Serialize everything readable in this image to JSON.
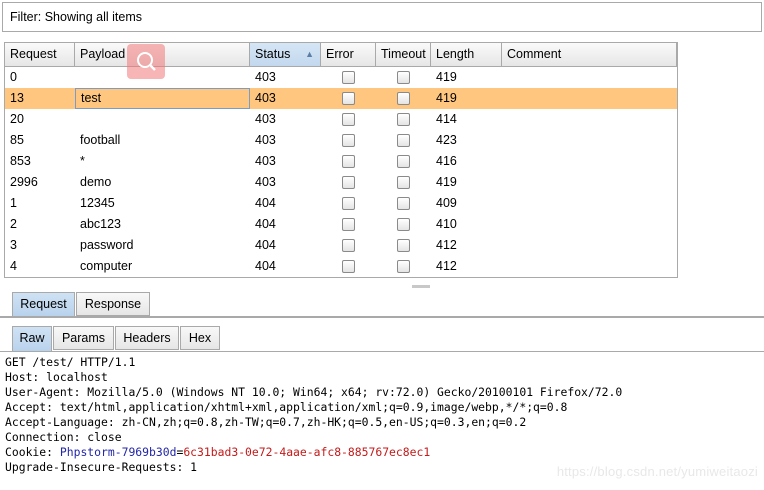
{
  "filter": {
    "label": "Filter: Showing all items"
  },
  "table": {
    "columns": [
      "Request",
      "Payload",
      "Status",
      "Error",
      "Timeout",
      "Length",
      "Comment"
    ],
    "sorted_column": "Status",
    "sort_indicator": "▲",
    "rows": [
      {
        "request": "0",
        "payload": "",
        "status": "403",
        "error": false,
        "timeout": false,
        "length": "419",
        "comment": ""
      },
      {
        "request": "13",
        "payload": "test",
        "status": "403",
        "error": false,
        "timeout": false,
        "length": "419",
        "comment": "",
        "selected": true
      },
      {
        "request": "20",
        "payload": "",
        "status": "403",
        "error": false,
        "timeout": false,
        "length": "414",
        "comment": ""
      },
      {
        "request": "85",
        "payload": "football",
        "status": "403",
        "error": false,
        "timeout": false,
        "length": "423",
        "comment": ""
      },
      {
        "request": "853",
        "payload": "*",
        "status": "403",
        "error": false,
        "timeout": false,
        "length": "416",
        "comment": ""
      },
      {
        "request": "2996",
        "payload": "demo",
        "status": "403",
        "error": false,
        "timeout": false,
        "length": "419",
        "comment": ""
      },
      {
        "request": "1",
        "payload": "12345",
        "status": "404",
        "error": false,
        "timeout": false,
        "length": "409",
        "comment": ""
      },
      {
        "request": "2",
        "payload": "abc123",
        "status": "404",
        "error": false,
        "timeout": false,
        "length": "410",
        "comment": ""
      },
      {
        "request": "3",
        "payload": "password",
        "status": "404",
        "error": false,
        "timeout": false,
        "length": "412",
        "comment": ""
      },
      {
        "request": "4",
        "payload": "computer",
        "status": "404",
        "error": false,
        "timeout": false,
        "length": "412",
        "comment": ""
      }
    ]
  },
  "outer_tabs": [
    {
      "label": "Request",
      "active": true
    },
    {
      "label": "Response",
      "active": false
    }
  ],
  "inner_tabs": [
    {
      "label": "Raw",
      "active": true
    },
    {
      "label": "Params",
      "active": false
    },
    {
      "label": "Headers",
      "active": false
    },
    {
      "label": "Hex",
      "active": false
    }
  ],
  "raw": {
    "lines": [
      "GET /test/ HTTP/1.1",
      "Host: localhost",
      "User-Agent: Mozilla/5.0 (Windows NT 10.0; Win64; x64; rv:72.0) Gecko/20100101 Firefox/72.0",
      "Accept: text/html,application/xhtml+xml,application/xml;q=0.9,image/webp,*/*;q=0.8",
      "Accept-Language: zh-CN,zh;q=0.8,zh-TW;q=0.7,zh-HK;q=0.5,en-US;q=0.3,en;q=0.2",
      "Connection: close"
    ],
    "cookie": {
      "label": "Cookie: ",
      "name": "Phpstorm-7969b30d",
      "equals": "=",
      "value": "6c31bad3-0e72-4aae-afc8-885767ec8ec1"
    },
    "last_line": "Upgrade-Insecure-Requests: 1"
  },
  "watermark": "https://blog.csdn.net/yumiweitaozi",
  "icons": {
    "search_overlay": "magnifier-icon",
    "checkbox": "checkbox-icon",
    "sort": "sort-ascending-icon"
  },
  "colors": {
    "selected_row": "#ffc680",
    "accent_tab": "#cfe2f4",
    "cookie_name": "#2226a8",
    "cookie_value": "#c41a1a"
  }
}
